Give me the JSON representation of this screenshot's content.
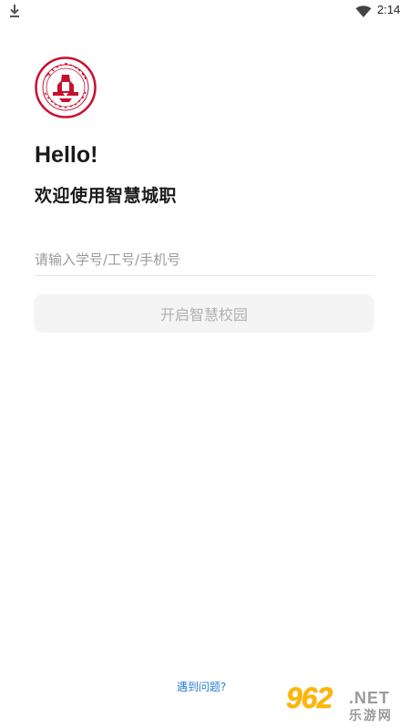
{
  "status_bar": {
    "time": "2:14"
  },
  "logo": {
    "name": "school-seal",
    "accent": "#c8102e"
  },
  "greeting": {
    "hello": "Hello!",
    "welcome": "欢迎使用智慧城职"
  },
  "login": {
    "account_placeholder": "请输入学号/工号/手机号",
    "account_value": "",
    "submit_label": "开启智慧校园"
  },
  "footer": {
    "help_link": "遇到问题?"
  },
  "watermark": {
    "digits": "962",
    "suffix": ".NET",
    "site_name": "乐游网"
  },
  "colors": {
    "link": "#2a7fd4",
    "button_bg": "#f4f4f4",
    "button_text": "#b0b0b0",
    "placeholder": "#9a9a9a",
    "watermark_gold": "#ffb600"
  }
}
